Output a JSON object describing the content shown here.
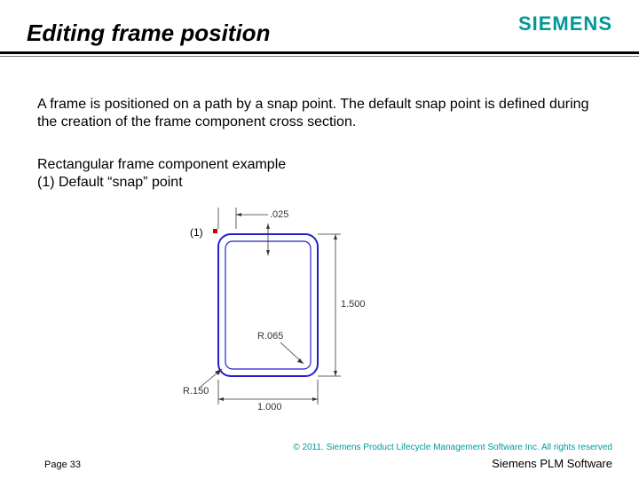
{
  "brand": "SIEMENS",
  "title": "Editing frame position",
  "body": "A frame is positioned on a path by a snap point. The default snap point is defined during the creation of the frame component cross section.",
  "example_line1": "Rectangular frame component example",
  "example_line2": "(1) Default “snap” point",
  "diagram": {
    "callout": "(1)",
    "dim_top": ".025",
    "dim_height": "1.500",
    "dim_fillet": "R.065",
    "dim_radius": "R.150",
    "dim_width": "1.000"
  },
  "footer": {
    "copyright": "© 2011. Siemens Product Lifecycle Management Software Inc. All rights reserved",
    "page": "Page 33",
    "product": "Siemens PLM Software"
  }
}
